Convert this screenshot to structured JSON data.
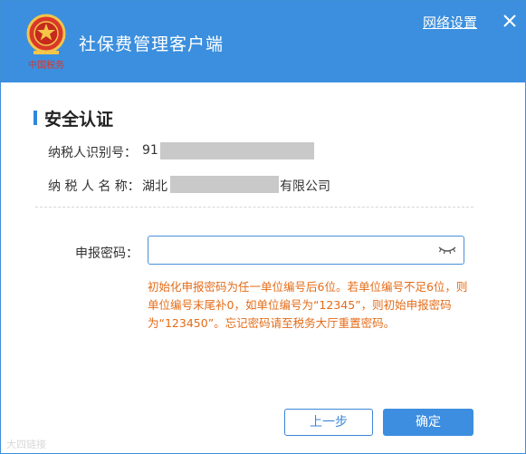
{
  "header": {
    "app_title": "社保费管理客户端",
    "logo_text": "中国税务",
    "network_settings": "网络设置",
    "close_icon": "close-icon"
  },
  "section": {
    "title": "安全认证"
  },
  "taxpayer": {
    "id_label": "纳税人识别号：",
    "id_value_prefix": "91",
    "name_label": "纳 税 人 名 称：",
    "name_prefix": "湖北",
    "name_suffix": "有限公司"
  },
  "password": {
    "label": "申报密码：",
    "value": "",
    "placeholder": "",
    "toggle_icon": "eye-closed-icon"
  },
  "hint": "初始化申报密码为任一单位编号后6位。若单位编号不足6位，则单位编号末尾补0，如单位编号为“12345”，则初始申报密码为“123450”。忘记密码请至税务大厅重置密码。",
  "buttons": {
    "back": "上一步",
    "confirm": "确定"
  },
  "watermark": "大四链接",
  "colors": {
    "header_bg": "#3b8fde",
    "accent": "#2f87df",
    "hint_text": "#e36c18",
    "primary_button": "#3d8ee0"
  }
}
